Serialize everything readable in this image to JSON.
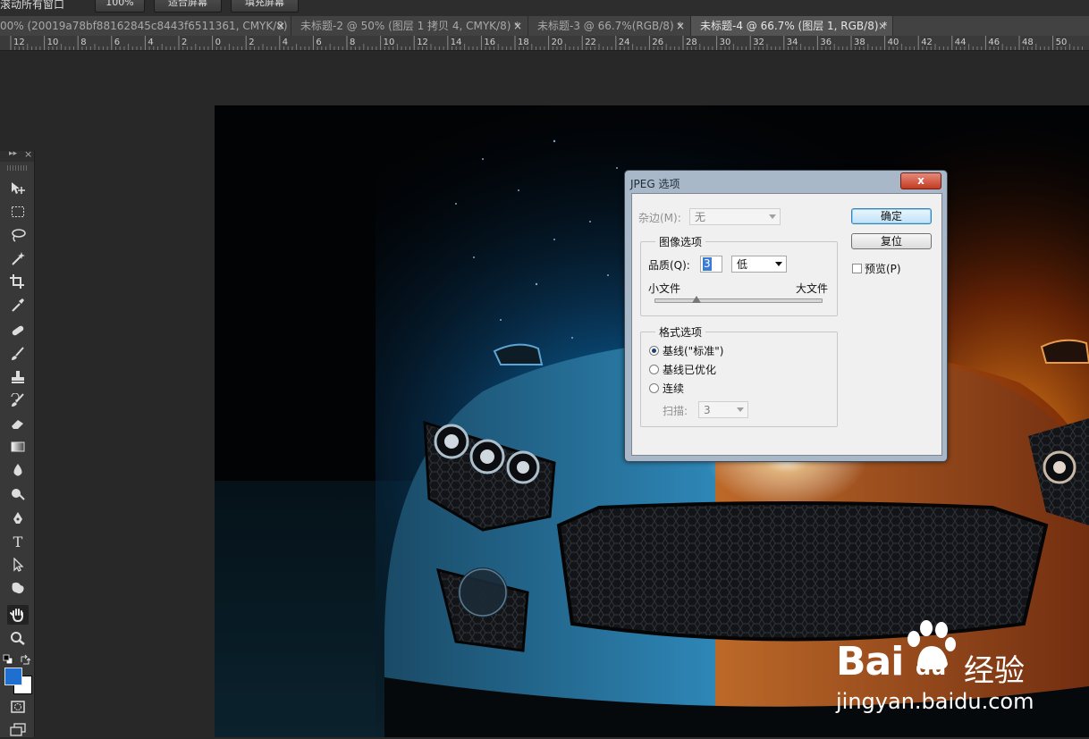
{
  "options_bar": {
    "scroll_all": "滚动所有窗口",
    "zoom_100": "100%",
    "fit_screen": "适合屏幕",
    "fill_screen": "填充屏幕"
  },
  "tabs": [
    {
      "label": "00% (20019a78bf88162845c8443f6511361, CMYK/8) *",
      "close": "×"
    },
    {
      "label": "未标题-2 @ 50% (图层 1 拷贝 4, CMYK/8) *",
      "close": "×"
    },
    {
      "label": "未标题-3 @ 66.7%(RGB/8) *",
      "close": "×"
    },
    {
      "label": "未标题-4 @ 66.7% (图层 1, RGB/8) *",
      "close": "×"
    }
  ],
  "ruler_labels": [
    "12",
    "10",
    "8",
    "6",
    "4",
    "2",
    "0",
    "2",
    "4",
    "6",
    "8",
    "10",
    "12",
    "14",
    "16",
    "18",
    "20",
    "22",
    "24",
    "26",
    "28",
    "30",
    "32",
    "34",
    "36",
    "38",
    "40",
    "42",
    "44",
    "46",
    "48",
    "50"
  ],
  "toolbar": {
    "expand": "▸▸",
    "close": "×",
    "foreground_color": "#1f6fd0",
    "background_color": "#ffffff"
  },
  "dialog": {
    "title": "JPEG 选项",
    "close": "x",
    "matte_label": "杂边(M):",
    "matte_value": "无",
    "image_options_title": "图像选项",
    "quality_label": "品质(Q):",
    "quality_value": "3",
    "quality_level": "低",
    "small_file": "小文件",
    "large_file": "大文件",
    "quality_slider": 3,
    "format_options_title": "格式选项",
    "format_options": [
      {
        "label": "基线(\"标准\")",
        "selected": true
      },
      {
        "label": "基线已优化",
        "selected": false
      },
      {
        "label": "连续",
        "selected": false
      }
    ],
    "scans_label": "扫描:",
    "scans_value": "3",
    "ok_button": "确定",
    "reset_button": "复位",
    "preview_label": "预览(P)",
    "preview_checked": false
  },
  "watermark": {
    "brand_text": "Bai",
    "brand_du": "du",
    "brand_cn": "经验",
    "url": "jingyan.baidu.com"
  }
}
